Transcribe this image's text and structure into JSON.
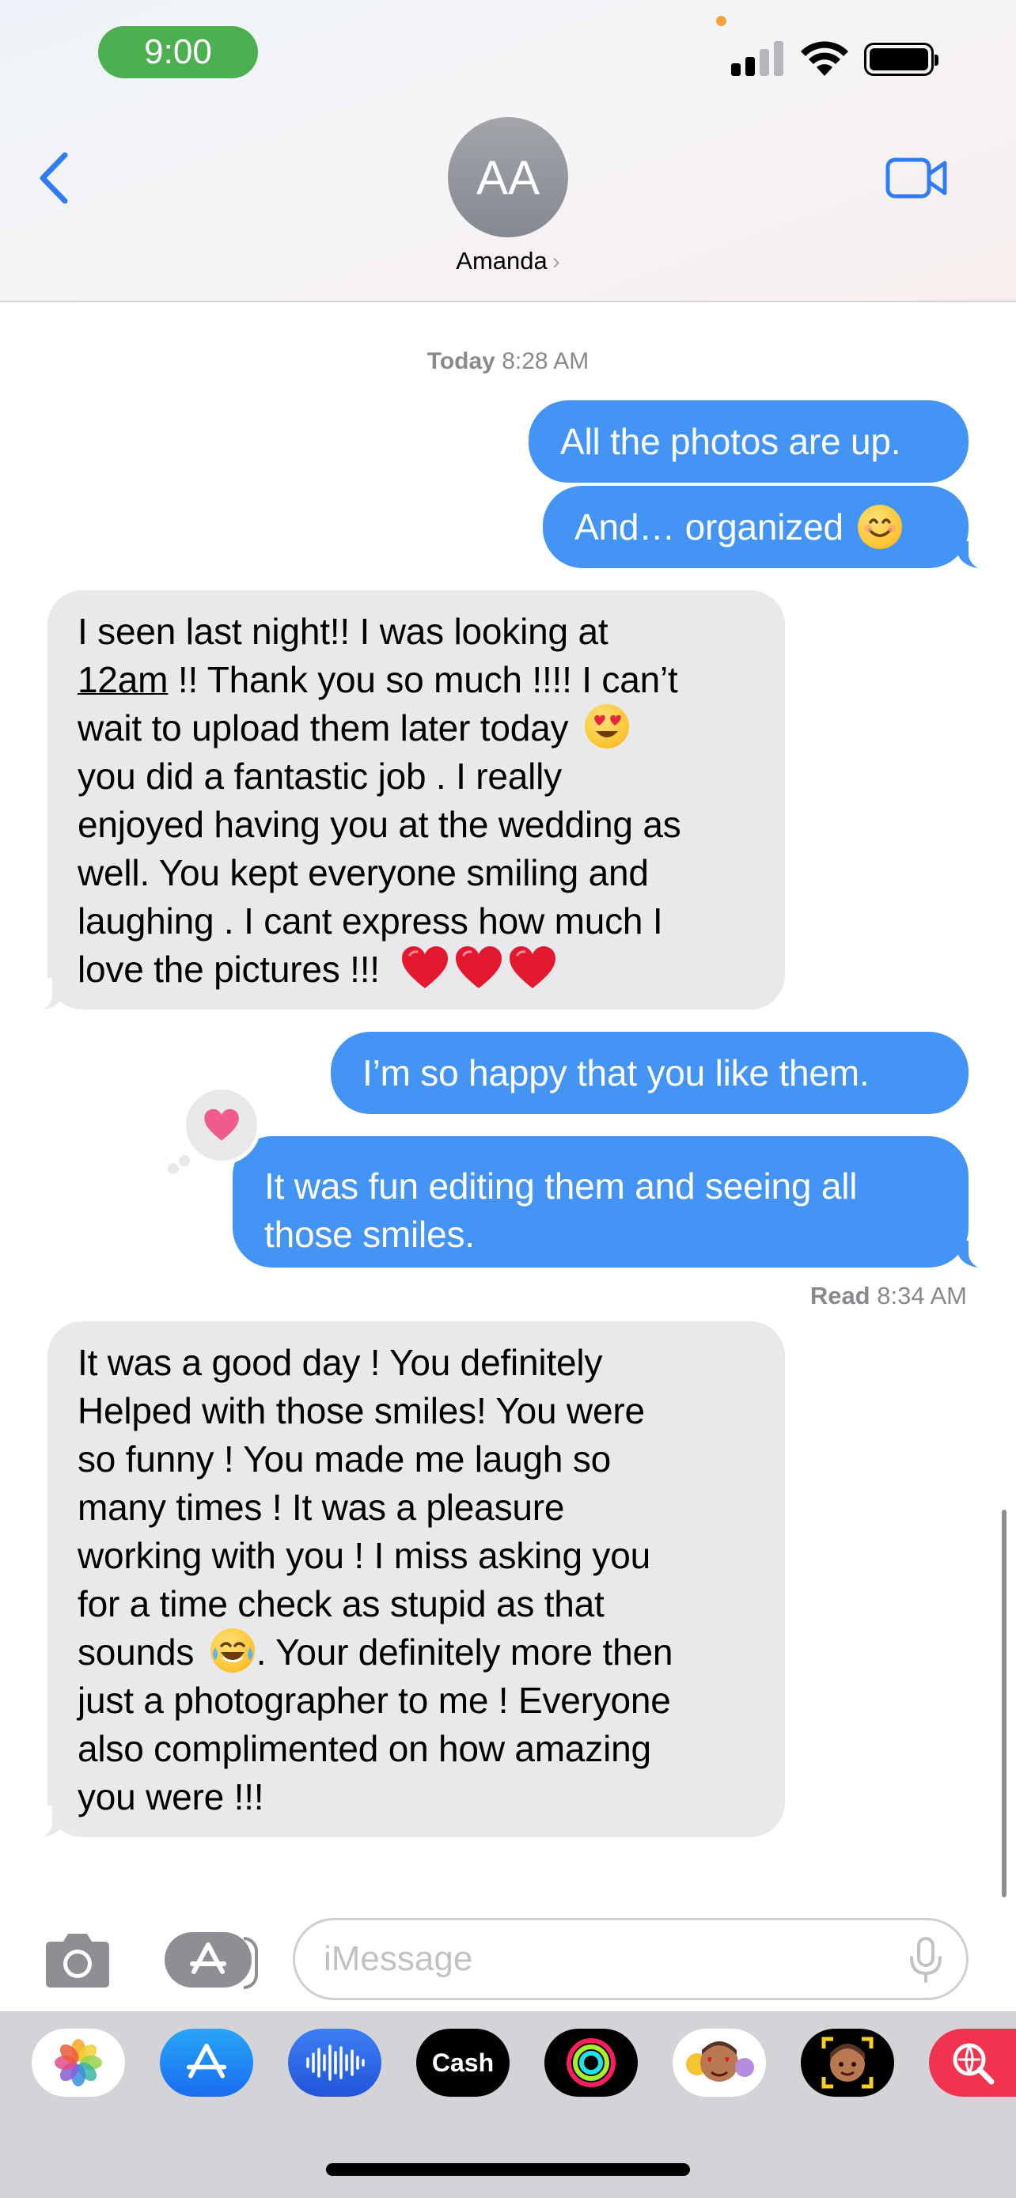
{
  "status_bar": {
    "time": "9:00"
  },
  "header": {
    "avatar_initials": "AA",
    "contact_name": "Amanda",
    "contact_chevron": "›"
  },
  "thread": {
    "timestamp": {
      "day": "Today",
      "time": "8:28 AM"
    },
    "messages": [
      {
        "direction": "outgoing",
        "text": "All the photos are up."
      },
      {
        "direction": "outgoing",
        "text": "And… organized",
        "emoji": "smiling-face"
      },
      {
        "direction": "incoming",
        "lines": [
          "I seen last night!! I was looking at",
          "12am",
          " !! Thank you so much !!!! I can’t",
          "wait to upload them later today",
          "you did a fantastic job . I really",
          "enjoyed having you at the wedding as",
          "well. You kept everyone smiling and",
          "laughing . I cant express how much I",
          "love the pictures !!!"
        ],
        "emojis": [
          "heart-eyes",
          "red-heart",
          "red-heart",
          "red-heart"
        ]
      },
      {
        "direction": "outgoing",
        "text": "I’m so happy that you like them."
      },
      {
        "direction": "outgoing",
        "lines": [
          "It was fun editing them and seeing all",
          "those smiles."
        ],
        "tapback": "heart"
      },
      {
        "direction": "incoming",
        "lines": [
          "It was a good day ! You definitely",
          "Helped with those smiles! You were",
          "so funny ! You made me laugh so",
          "many times ! It was a pleasure",
          "working with you ! I miss asking you",
          "for a time check as stupid as that",
          "sounds",
          ". Your definitely more then",
          "just a photographer to me ! Everyone",
          "also complimented on how amazing",
          "you were !!!"
        ],
        "emojis": [
          "tears-of-joy"
        ]
      }
    ],
    "read_receipt": {
      "label": "Read",
      "time": "8:34 AM"
    }
  },
  "composer": {
    "placeholder": "iMessage"
  },
  "app_drawer": {
    "apps": [
      {
        "name": "photos-app-icon"
      },
      {
        "name": "app-store-icon"
      },
      {
        "name": "audio-message-icon"
      },
      {
        "name": "apple-cash-icon",
        "label": "Cash",
        "symbol": ""
      },
      {
        "name": "activity-icon"
      },
      {
        "name": "memoji-stickers-icon"
      },
      {
        "name": "memoji-icon"
      },
      {
        "name": "search-images-icon"
      }
    ]
  },
  "colors": {
    "outgoing_bubble": "#4394f5",
    "incoming_bubble": "#e9e9eb",
    "accent_blue": "#2f7cf6",
    "time_pill": "#4caf50",
    "tapback_heart": "#ef5b8c"
  }
}
